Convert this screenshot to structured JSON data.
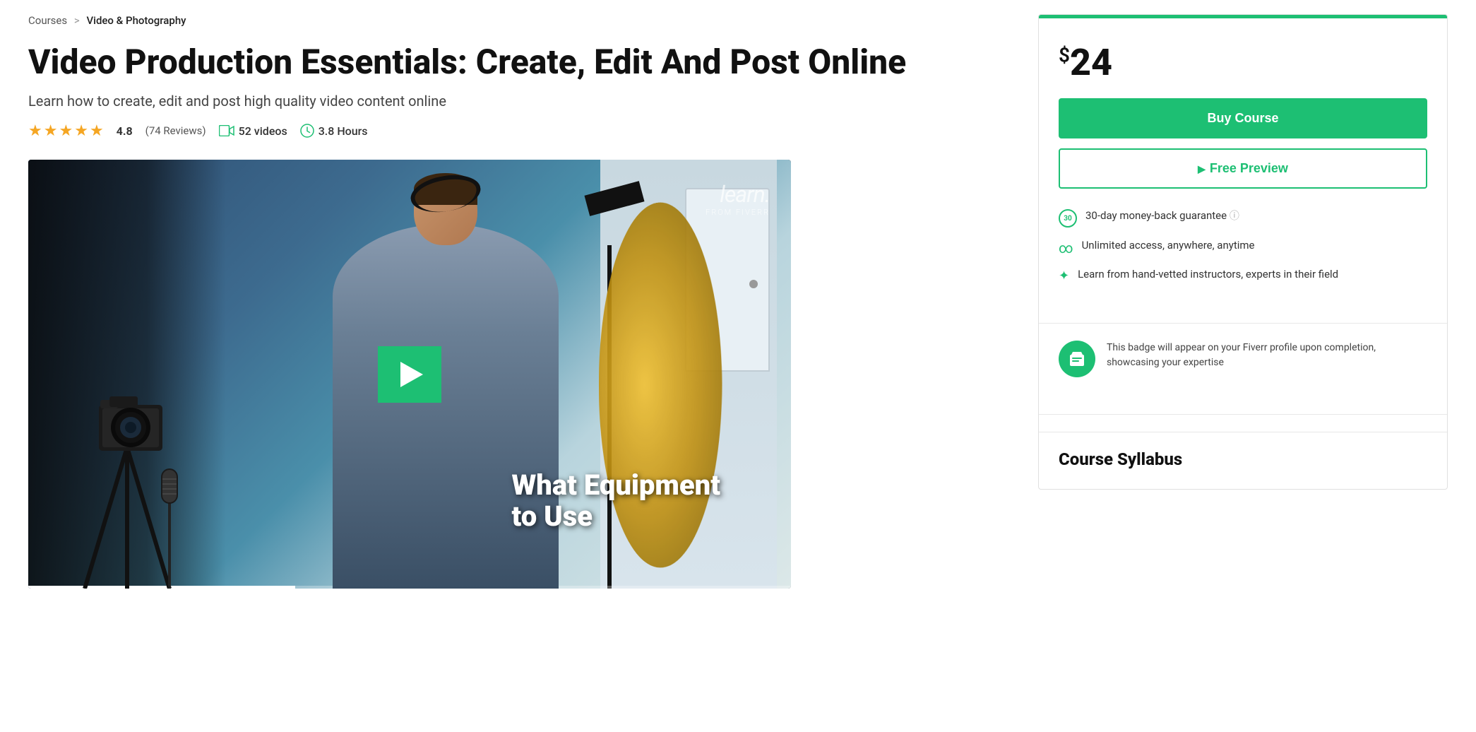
{
  "breadcrumb": {
    "parent": "Courses",
    "separator": ">",
    "current": "Video & Photography"
  },
  "course": {
    "title": "Video Production Essentials: Create, Edit And Post Online",
    "subtitle": "Learn how to create, edit and post high quality video content online",
    "rating": {
      "score": "4.8",
      "reviews": "74 Reviews",
      "stars": 5
    },
    "videos": "52 videos",
    "hours": "3.8 Hours"
  },
  "video": {
    "overlay_text_line1": "What Equipment",
    "overlay_text_line2": "to Use",
    "watermark_line1": "learn.",
    "watermark_line2": "FROM FIVERR"
  },
  "sidebar": {
    "price": "24",
    "price_symbol": "$",
    "buy_label": "Buy Course",
    "preview_label": "Free Preview",
    "features": [
      {
        "icon": "30",
        "text": "30-day money-back guarantee"
      },
      {
        "icon": "∞",
        "text": "Unlimited access, anywhere, anytime"
      },
      {
        "icon": "✦",
        "text": "Learn from hand-vetted instructors, experts in their field"
      }
    ],
    "badge_text": "This badge will appear on your Fiverr profile upon completion, showcasing your expertise",
    "syllabus_title": "Course Syllabus"
  }
}
